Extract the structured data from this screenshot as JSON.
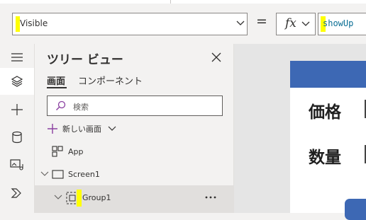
{
  "formula_bar": {
    "property": "Visible",
    "equals": "=",
    "fx_label": "fx",
    "formula": "showUp"
  },
  "rail": {
    "icons": [
      "hamburger-icon",
      "layers-icon",
      "plus-icon",
      "database-icon",
      "media-icon",
      "chevron-double-icon"
    ]
  },
  "tree_view": {
    "title": "ツリー ビュー",
    "tabs": [
      "画面",
      "コンポーネント"
    ],
    "active_tab": "画面",
    "search_placeholder": "検索",
    "new_screen_label": "新しい画面",
    "items": [
      {
        "label": "App"
      },
      {
        "label": "Screen1"
      },
      {
        "label": "Group1"
      }
    ]
  },
  "canvas": {
    "price_label": "価格",
    "quantity_label": "数量"
  },
  "colors": {
    "accent": "#3d68b4",
    "highlight": "#ffff00",
    "formula_text": "#0a6e94",
    "plus_purple": "#8a3fa0"
  }
}
